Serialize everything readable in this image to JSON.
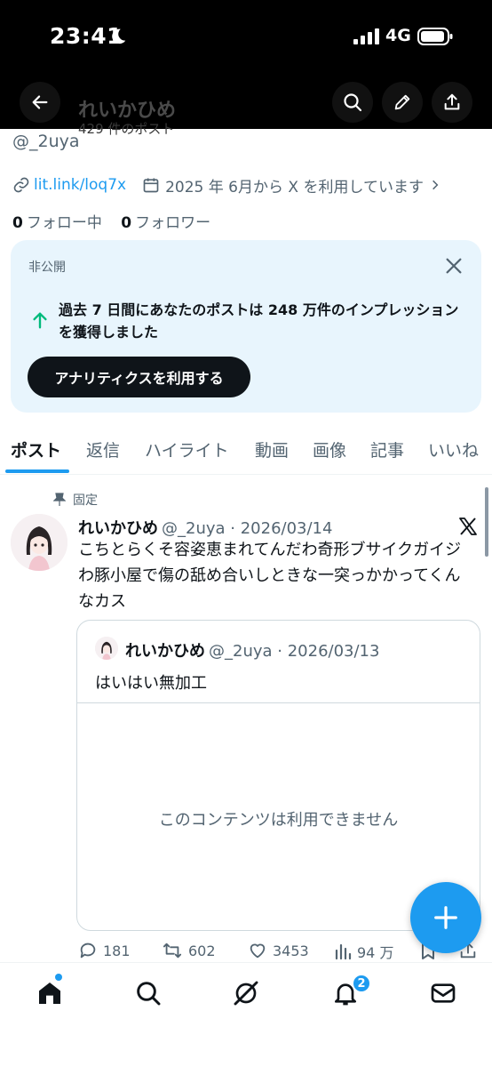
{
  "status_bar": {
    "time": "23:41",
    "network": "4G"
  },
  "nav": {
    "title": "れいかひめ",
    "subtitle": "429 件のポスト"
  },
  "profile": {
    "handle": "@_2uya",
    "link": "lit.link/loq7x",
    "joined": "2025 年 6月から X を利用しています",
    "following_count": "0",
    "following_label": "フォロー中",
    "followers_count": "0",
    "followers_label": "フォロワー"
  },
  "analytics_card": {
    "private_label": "非公開",
    "message": "過去 7 日間にあなたのポストは 248 万件のインプレッションを獲得しました",
    "button_label": "アナリティクスを利用する"
  },
  "tabs": [
    "ポスト",
    "返信",
    "ハイライト",
    "動画",
    "画像",
    "記事",
    "いいね"
  ],
  "pinned_post": {
    "pinned_label": "固定",
    "name": "れいかひめ",
    "handle_date": "@_2uya · 2026/03/14",
    "text": "こちとらくそ容姿恵まれてんだわ奇形ブサイクガイジわ豚小屋で傷の舐め合いしときな一突っかかってくんなカス",
    "quote": {
      "name": "れいかひめ",
      "handle_date": "@_2uya · 2026/03/13",
      "text": "はいはい無加工",
      "unavailable": "このコンテンツは利用できません"
    },
    "replies": "181",
    "reposts": "602",
    "likes": "3453",
    "views": "94 万"
  },
  "notifications_badge": "2",
  "colors": {
    "accent": "#1d9bf0",
    "card_bg": "#e8f5fd",
    "text_secondary": "#536471"
  }
}
